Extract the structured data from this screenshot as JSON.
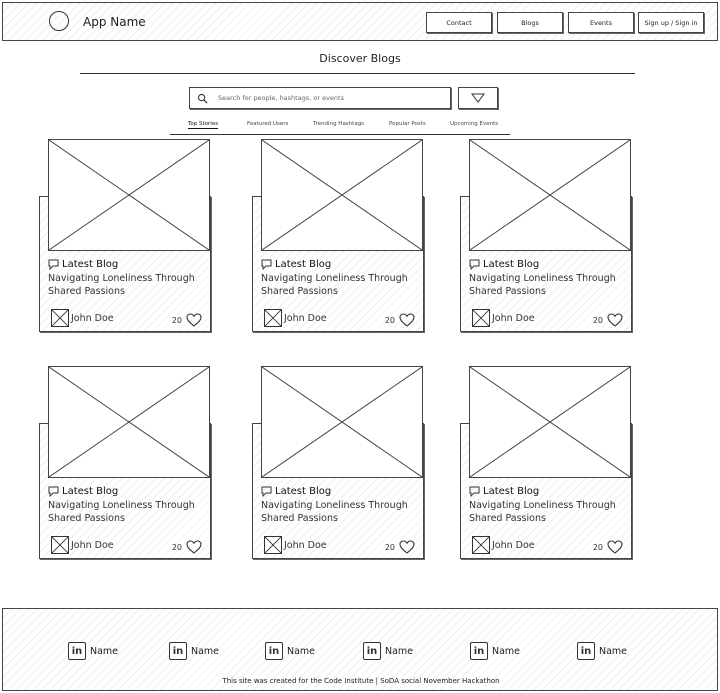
{
  "header": {
    "app_name": "App Name",
    "nav": [
      "Contact",
      "Blogs",
      "Events",
      "Sign up / Sign in"
    ]
  },
  "page": {
    "title": "Discover Blogs"
  },
  "search": {
    "placeholder": "Search for people, hashtags, or events"
  },
  "tabs": [
    "Top Stories",
    "Featured Users",
    "Trending Hashtags",
    "Popular Posts",
    "Upcoming Events"
  ],
  "cards": [
    {
      "type": "Latest Blog",
      "title": "Navigating Loneliness Through Shared Passions",
      "author": "John Doe",
      "likes": "20"
    },
    {
      "type": "Latest Blog",
      "title": "Navigating Loneliness Through Shared Passions",
      "author": "John Doe",
      "likes": "20"
    },
    {
      "type": "Latest Blog",
      "title": "Navigating Loneliness Through Shared Passions",
      "author": "John Doe",
      "likes": "20"
    },
    {
      "type": "Latest Blog",
      "title": "Navigating Loneliness Through Shared Passions",
      "author": "John Doe",
      "likes": "20"
    },
    {
      "type": "Latest Blog",
      "title": "Navigating Loneliness Through Shared Passions",
      "author": "John Doe",
      "likes": "20"
    },
    {
      "type": "Latest Blog",
      "title": "Navigating Loneliness Through Shared Passions",
      "author": "John Doe",
      "likes": "20"
    }
  ],
  "footer": {
    "social_icon": "in",
    "socials": [
      "Name",
      "Name",
      "Name",
      "Name",
      "Name",
      "Name"
    ],
    "credit": "This site was created for the Code Institute | SoDA social November Hackathon"
  }
}
